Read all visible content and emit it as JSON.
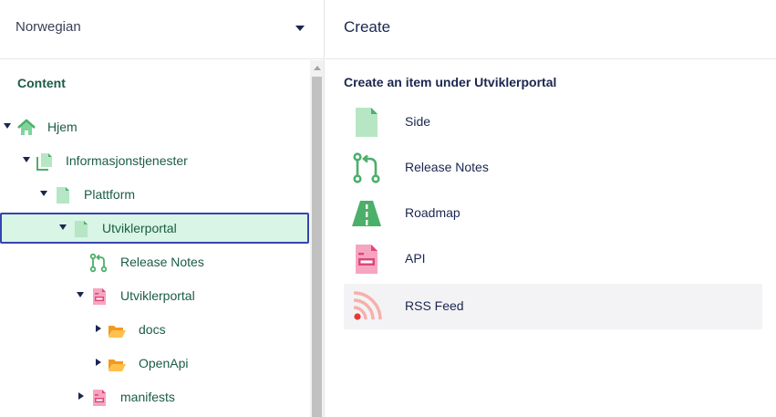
{
  "language": {
    "selected": "Norwegian"
  },
  "tree": {
    "section_title": "Content",
    "nodes": [
      {
        "label": "Hjem",
        "icon": "home-icon"
      },
      {
        "label": "Informasjonstjenester",
        "icon": "documents-icon"
      },
      {
        "label": "Plattform",
        "icon": "document-icon"
      },
      {
        "label": "Utviklerportal",
        "icon": "document-icon"
      },
      {
        "label": "Release Notes",
        "icon": "release-notes-icon"
      },
      {
        "label": "Utviklerportal",
        "icon": "api-document-icon"
      },
      {
        "label": "docs",
        "icon": "folder-open-icon"
      },
      {
        "label": "OpenApi",
        "icon": "folder-open-icon"
      },
      {
        "label": "manifests",
        "icon": "api-document-icon"
      }
    ]
  },
  "create": {
    "title": "Create",
    "heading": "Create an item under Utviklerportal",
    "items": [
      {
        "label": "Side",
        "icon": "page-icon"
      },
      {
        "label": "Release Notes",
        "icon": "release-notes-icon"
      },
      {
        "label": "Roadmap",
        "icon": "road-icon"
      },
      {
        "label": "API",
        "icon": "api-document-icon"
      },
      {
        "label": "RSS Feed",
        "icon": "rss-icon"
      }
    ]
  },
  "colors": {
    "tree_text": "#1a5c44",
    "selected_bg": "#d9f5e6",
    "selected_border": "#3544b1",
    "hover_bg": "#f3f3f5"
  }
}
